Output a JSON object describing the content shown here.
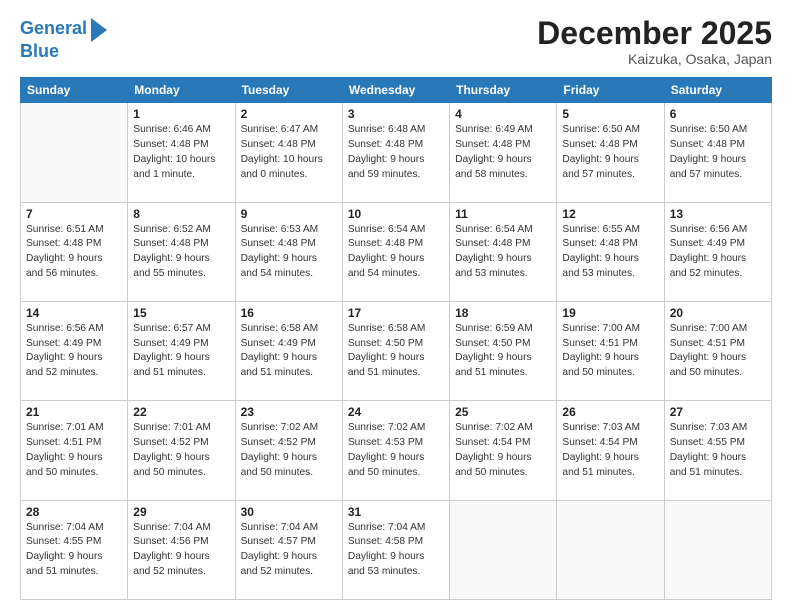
{
  "header": {
    "logo_line1": "General",
    "logo_line2": "Blue",
    "month": "December 2025",
    "location": "Kaizuka, Osaka, Japan"
  },
  "weekdays": [
    "Sunday",
    "Monday",
    "Tuesday",
    "Wednesday",
    "Thursday",
    "Friday",
    "Saturday"
  ],
  "weeks": [
    [
      {
        "day": "",
        "info": ""
      },
      {
        "day": "1",
        "info": "Sunrise: 6:46 AM\nSunset: 4:48 PM\nDaylight: 10 hours\nand 1 minute."
      },
      {
        "day": "2",
        "info": "Sunrise: 6:47 AM\nSunset: 4:48 PM\nDaylight: 10 hours\nand 0 minutes."
      },
      {
        "day": "3",
        "info": "Sunrise: 6:48 AM\nSunset: 4:48 PM\nDaylight: 9 hours\nand 59 minutes."
      },
      {
        "day": "4",
        "info": "Sunrise: 6:49 AM\nSunset: 4:48 PM\nDaylight: 9 hours\nand 58 minutes."
      },
      {
        "day": "5",
        "info": "Sunrise: 6:50 AM\nSunset: 4:48 PM\nDaylight: 9 hours\nand 57 minutes."
      },
      {
        "day": "6",
        "info": "Sunrise: 6:50 AM\nSunset: 4:48 PM\nDaylight: 9 hours\nand 57 minutes."
      }
    ],
    [
      {
        "day": "7",
        "info": "Sunrise: 6:51 AM\nSunset: 4:48 PM\nDaylight: 9 hours\nand 56 minutes."
      },
      {
        "day": "8",
        "info": "Sunrise: 6:52 AM\nSunset: 4:48 PM\nDaylight: 9 hours\nand 55 minutes."
      },
      {
        "day": "9",
        "info": "Sunrise: 6:53 AM\nSunset: 4:48 PM\nDaylight: 9 hours\nand 54 minutes."
      },
      {
        "day": "10",
        "info": "Sunrise: 6:54 AM\nSunset: 4:48 PM\nDaylight: 9 hours\nand 54 minutes."
      },
      {
        "day": "11",
        "info": "Sunrise: 6:54 AM\nSunset: 4:48 PM\nDaylight: 9 hours\nand 53 minutes."
      },
      {
        "day": "12",
        "info": "Sunrise: 6:55 AM\nSunset: 4:48 PM\nDaylight: 9 hours\nand 53 minutes."
      },
      {
        "day": "13",
        "info": "Sunrise: 6:56 AM\nSunset: 4:49 PM\nDaylight: 9 hours\nand 52 minutes."
      }
    ],
    [
      {
        "day": "14",
        "info": "Sunrise: 6:56 AM\nSunset: 4:49 PM\nDaylight: 9 hours\nand 52 minutes."
      },
      {
        "day": "15",
        "info": "Sunrise: 6:57 AM\nSunset: 4:49 PM\nDaylight: 9 hours\nand 51 minutes."
      },
      {
        "day": "16",
        "info": "Sunrise: 6:58 AM\nSunset: 4:49 PM\nDaylight: 9 hours\nand 51 minutes."
      },
      {
        "day": "17",
        "info": "Sunrise: 6:58 AM\nSunset: 4:50 PM\nDaylight: 9 hours\nand 51 minutes."
      },
      {
        "day": "18",
        "info": "Sunrise: 6:59 AM\nSunset: 4:50 PM\nDaylight: 9 hours\nand 51 minutes."
      },
      {
        "day": "19",
        "info": "Sunrise: 7:00 AM\nSunset: 4:51 PM\nDaylight: 9 hours\nand 50 minutes."
      },
      {
        "day": "20",
        "info": "Sunrise: 7:00 AM\nSunset: 4:51 PM\nDaylight: 9 hours\nand 50 minutes."
      }
    ],
    [
      {
        "day": "21",
        "info": "Sunrise: 7:01 AM\nSunset: 4:51 PM\nDaylight: 9 hours\nand 50 minutes."
      },
      {
        "day": "22",
        "info": "Sunrise: 7:01 AM\nSunset: 4:52 PM\nDaylight: 9 hours\nand 50 minutes."
      },
      {
        "day": "23",
        "info": "Sunrise: 7:02 AM\nSunset: 4:52 PM\nDaylight: 9 hours\nand 50 minutes."
      },
      {
        "day": "24",
        "info": "Sunrise: 7:02 AM\nSunset: 4:53 PM\nDaylight: 9 hours\nand 50 minutes."
      },
      {
        "day": "25",
        "info": "Sunrise: 7:02 AM\nSunset: 4:54 PM\nDaylight: 9 hours\nand 50 minutes."
      },
      {
        "day": "26",
        "info": "Sunrise: 7:03 AM\nSunset: 4:54 PM\nDaylight: 9 hours\nand 51 minutes."
      },
      {
        "day": "27",
        "info": "Sunrise: 7:03 AM\nSunset: 4:55 PM\nDaylight: 9 hours\nand 51 minutes."
      }
    ],
    [
      {
        "day": "28",
        "info": "Sunrise: 7:04 AM\nSunset: 4:55 PM\nDaylight: 9 hours\nand 51 minutes."
      },
      {
        "day": "29",
        "info": "Sunrise: 7:04 AM\nSunset: 4:56 PM\nDaylight: 9 hours\nand 52 minutes."
      },
      {
        "day": "30",
        "info": "Sunrise: 7:04 AM\nSunset: 4:57 PM\nDaylight: 9 hours\nand 52 minutes."
      },
      {
        "day": "31",
        "info": "Sunrise: 7:04 AM\nSunset: 4:58 PM\nDaylight: 9 hours\nand 53 minutes."
      },
      {
        "day": "",
        "info": ""
      },
      {
        "day": "",
        "info": ""
      },
      {
        "day": "",
        "info": ""
      }
    ]
  ]
}
